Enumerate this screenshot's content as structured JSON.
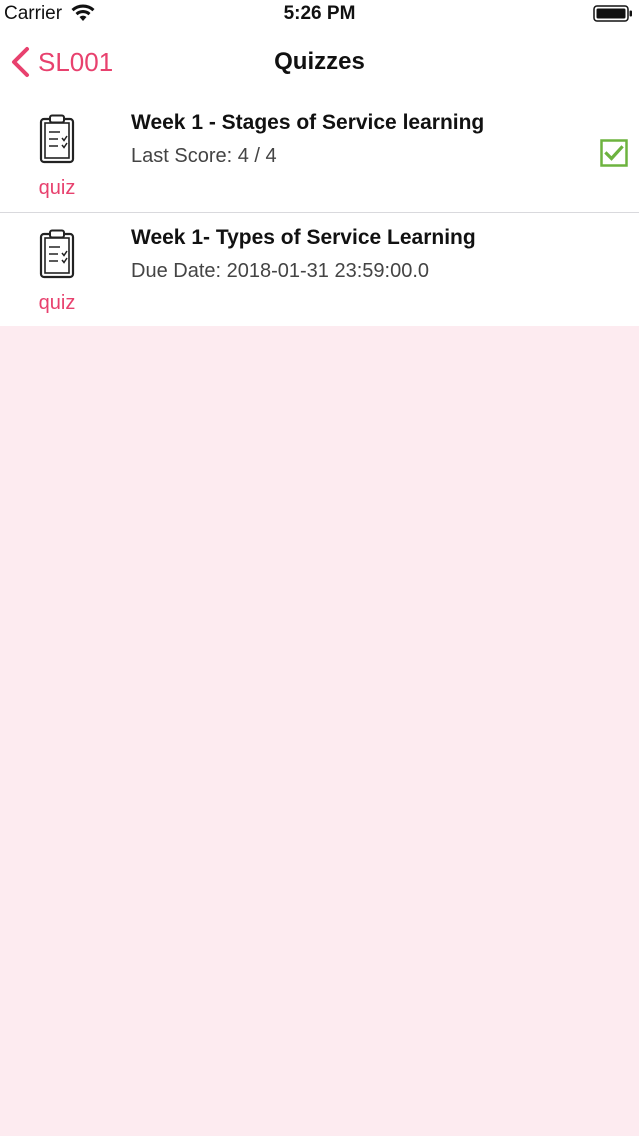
{
  "status_bar": {
    "carrier": "Carrier",
    "time": "5:26 PM",
    "wifi_icon": "wifi-icon",
    "battery_icon": "battery-icon"
  },
  "nav": {
    "back_label": "SL001",
    "title": "Quizzes",
    "accent_color": "#e8416e"
  },
  "quizzes": [
    {
      "title": "Week 1 - Stages of Service learning",
      "subtitle": "Last Score: 4 / 4",
      "type_label": "quiz",
      "completed": true
    },
    {
      "title": "Week 1- Types of Service Learning",
      "subtitle": "Due Date: 2018-01-31 23:59:00.0",
      "type_label": "quiz",
      "completed": false
    }
  ],
  "colors": {
    "accent": "#e8416e",
    "check": "#6db33f",
    "background": "#fdebf0"
  }
}
